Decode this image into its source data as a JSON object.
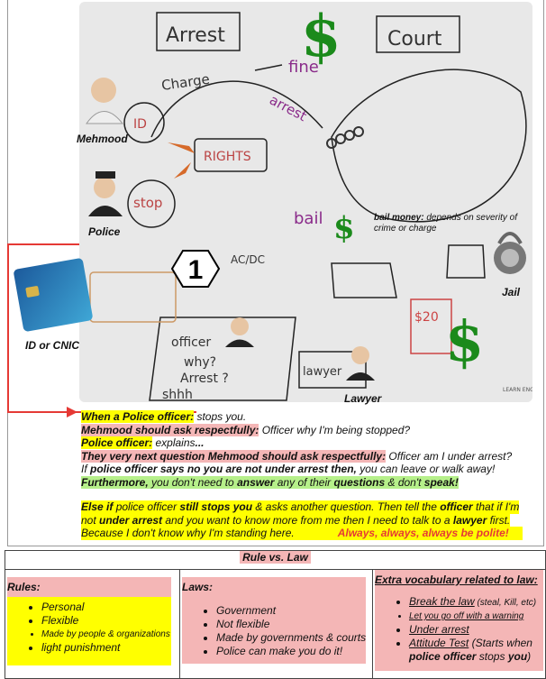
{
  "whiteboard": {
    "words": {
      "arrest": "Arrest",
      "court": "Court",
      "charge": "Charge",
      "fine": "fine",
      "arrest_path": "arrest",
      "rights": "RIGHTS",
      "id": "ID",
      "stop": "stop",
      "bail": "bail",
      "officer": "officer",
      "why": "why?",
      "arrest_q": "Arrest ?",
      "shhh": "shhh",
      "lawyer": "lawyer",
      "twenty": "$20",
      "acdc": "AC/DC",
      "learn_english": "LEARN ENGLISH"
    },
    "bail_note_bold": "bail money:",
    "bail_note_text": " depends on severity of crime or charge"
  },
  "labels": {
    "mehmood": "Mehmood",
    "police": "Police",
    "jail": "Jail",
    "id_card": "ID or CNIC",
    "lawyer": "Lawyer",
    "badge": "1"
  },
  "dialogue": {
    "l1a": "When a Police officer:",
    "l1b": " stops you.",
    "l2a": "Mehmood should ask respectfully:",
    "l2b": " Officer why I'm being stopped?",
    "l3a": "Police officer:",
    "l3b": " explains",
    "l3c": "...",
    "l4a": "They very next question Mehmood should ask respectfully:",
    "l4b": " Officer am I under arrest?",
    "l5a": "If ",
    "l5b": "police officer says no you are not under arrest then,",
    "l5c": " you can leave or walk away!",
    "l6a": "Furthermore,",
    "l6b": " you don't need to ",
    "l6c": "answer",
    "l6d": " any of their ",
    "l6e": "questions",
    "l6f": " & don't ",
    "l6g": "speak!",
    "l7a": "Else if",
    "l7b": " police officer ",
    "l7c": "still stops you",
    "l7d": " & asks another question. Then tell the ",
    "l7e": "officer",
    "l7f": " that if I'm",
    "l8a": "not ",
    "l8b": "under arrest",
    "l8c": " and you want to know more from me then I need to talk to a ",
    "l8d": "lawyer",
    "l8e": " first.",
    "l9a": "Because I don't know why I'm standing here.",
    "l9b": "Always, always, always be polite!"
  },
  "table": {
    "header": "Rule vs. Law",
    "rules_title": "Rules:",
    "rules": [
      "Personal",
      "Flexible",
      "Made by people & organizations",
      "light punishment"
    ],
    "laws_title": "Laws:",
    "laws": [
      "Government",
      "Not flexible",
      "Made by governments & courts",
      "Police can make you do it!"
    ],
    "vocab_title": "Extra vocabulary related to law:",
    "vocab": [
      {
        "term": "Break the law",
        "note": " (steal, Kill, etc)"
      },
      {
        "term": "Let you go off with a warning",
        "note": ""
      },
      {
        "term": "Under arrest",
        "note": ""
      },
      {
        "term": "Attitude Test",
        "note": " (Starts when "
      }
    ],
    "vocab_attitude_b1": "police officer",
    "vocab_attitude_t2": " stops ",
    "vocab_attitude_b2": "you",
    "vocab_attitude_t3": ")"
  }
}
